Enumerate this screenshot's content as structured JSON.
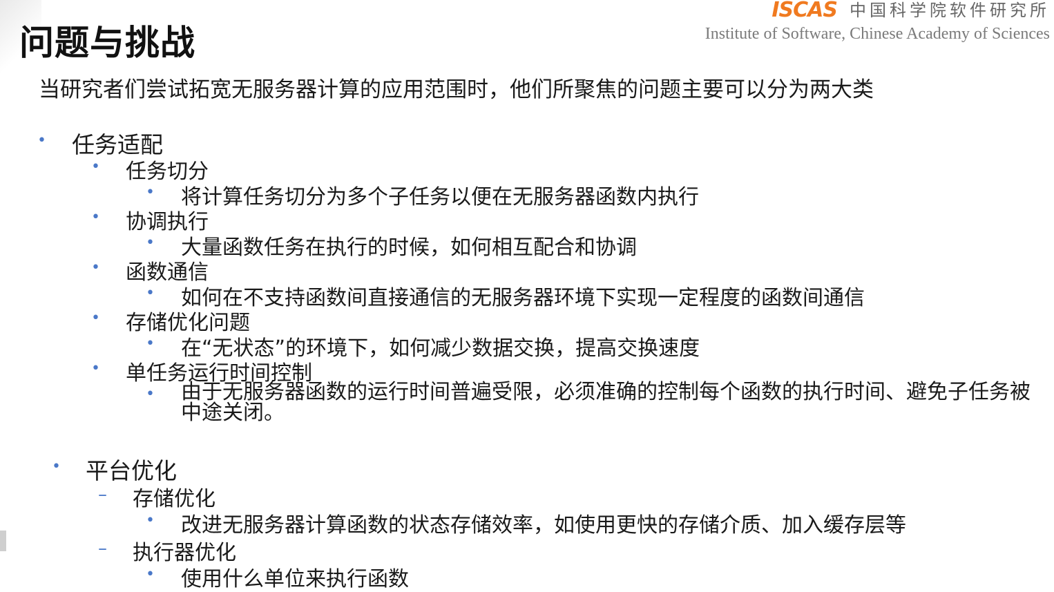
{
  "title": "问题与挑战",
  "logo": {
    "mark": "ISCAS",
    "cn": "中国科学院软件研究所",
    "en": "Institute of Software, Chinese Academy of Sciences"
  },
  "intro": "当研究者们尝试拓宽无服务器计算的应用范围时，他们所聚焦的问题主要可以分为两大类",
  "sections": [
    {
      "label": "任务适配",
      "items": [
        {
          "label": "任务切分",
          "detail": "将计算任务切分为多个子任务以便在无服务器函数内执行"
        },
        {
          "label": "协调执行",
          "detail": "大量函数任务在执行的时候，如何相互配合和协调"
        },
        {
          "label": "函数通信",
          "detail": "如何在不支持函数间直接通信的无服务器环境下实现一定程度的函数间通信"
        },
        {
          "label": "存储优化问题",
          "detail": "在“无状态”的环境下，如何减少数据交换，提高交换速度"
        },
        {
          "label": "单任务运行时间控制",
          "detail": "由于无服务器函数的运行时间普遍受限，必须准确的控制每个函数的执行时间、避免子任务被中途关闭。"
        }
      ]
    },
    {
      "label": "平台优化",
      "items": [
        {
          "label": "存储优化",
          "detail": "改进无服务器计算函数的状态存储效率，如使用更快的存储介质、加入缓存层等"
        },
        {
          "label": "执行器优化",
          "detail": "使用什么单位来执行函数"
        }
      ]
    }
  ],
  "colors": {
    "bullet": "#4a78c8",
    "logo_mark": "#f07a20"
  }
}
